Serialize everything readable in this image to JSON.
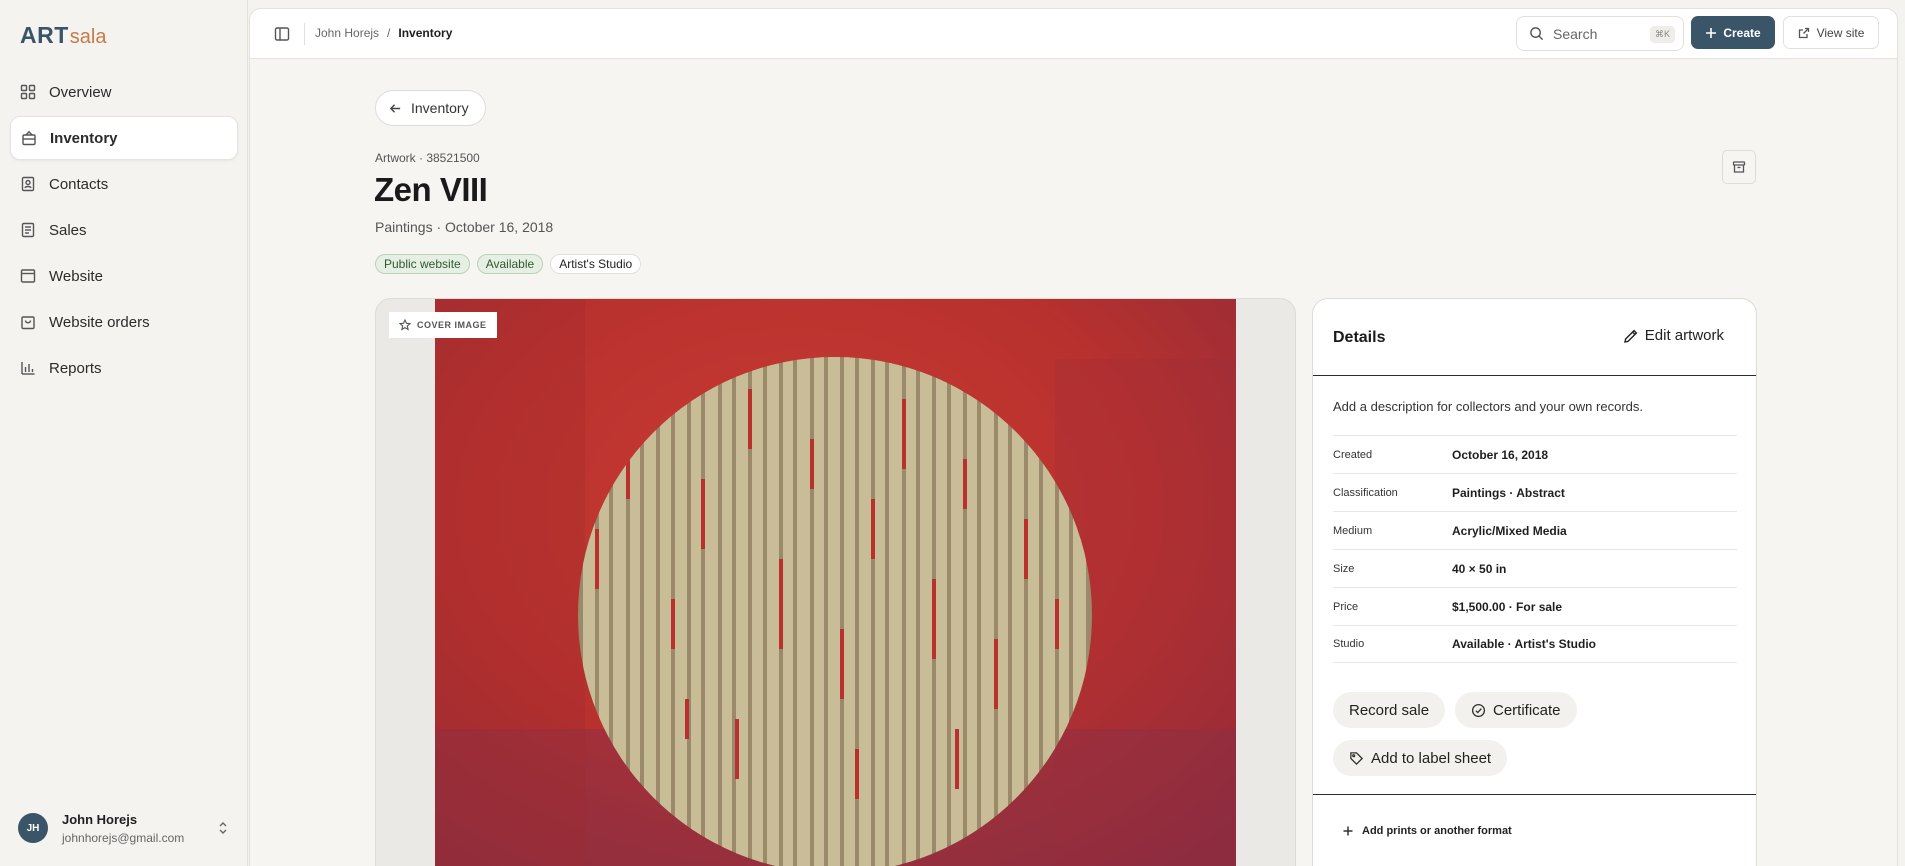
{
  "brand": {
    "logo_main": "ART",
    "logo_sub": "sala",
    "primary_color": "#3b5568",
    "accent_color": "#c97a4a"
  },
  "sidebar": {
    "items": [
      {
        "label": "Overview",
        "icon": "grid-icon"
      },
      {
        "label": "Inventory",
        "icon": "frame-icon",
        "active": true
      },
      {
        "label": "Contacts",
        "icon": "contact-book-icon"
      },
      {
        "label": "Sales",
        "icon": "receipt-icon"
      },
      {
        "label": "Website",
        "icon": "browser-icon"
      },
      {
        "label": "Website orders",
        "icon": "shopping-bag-icon"
      },
      {
        "label": "Reports",
        "icon": "bar-chart-icon"
      }
    ],
    "user": {
      "initials": "JH",
      "name": "John Horejs",
      "email": "johnhorejs@gmail.com"
    }
  },
  "topbar": {
    "breadcrumb": {
      "parent": "John Horejs",
      "separator": "/",
      "current": "Inventory"
    },
    "search": {
      "label": "Search",
      "shortcut": "⌘K"
    },
    "create_label": "Create",
    "view_site_label": "View site"
  },
  "artwork": {
    "back_label": "Inventory",
    "eyebrow": "Artwork · 38521500",
    "title": "Zen VIII",
    "subtitle": "Paintings · October 16, 2018",
    "badges": [
      "Public website",
      "Available",
      "Artist's Studio"
    ],
    "cover_label": "COVER IMAGE"
  },
  "details": {
    "title": "Details",
    "edit_label": "Edit artwork",
    "description_prompt": "Add a description for collectors and your own records.",
    "rows": [
      {
        "label": "Created",
        "value": "October 16, 2018"
      },
      {
        "label": "Classification",
        "value": "Paintings · Abstract"
      },
      {
        "label": "Medium",
        "value": "Acrylic/Mixed Media"
      },
      {
        "label": "Size",
        "value": "40 × 50 in"
      },
      {
        "label": "Price",
        "value": "$1,500.00 · For sale"
      },
      {
        "label": "Studio",
        "value": "Available · Artist's Studio"
      }
    ],
    "actions": {
      "record_sale": "Record sale",
      "certificate": "Certificate",
      "label_sheet": "Add to label sheet"
    },
    "add_prints_label": "Add prints or another format"
  }
}
